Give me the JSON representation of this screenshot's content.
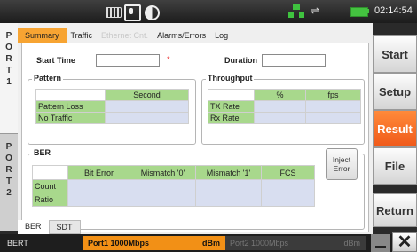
{
  "status_bar": {
    "time": "02:14:54",
    "icons": [
      "keyboard-icon",
      "screenshot-icon",
      "contrast-icon",
      "network-icon",
      "usb-icon",
      "battery-icon"
    ],
    "network_color": "#3fc23f",
    "battery_color": "#44c240"
  },
  "ports": {
    "port1": [
      "P",
      "O",
      "R",
      "T",
      "1"
    ],
    "port2": [
      "P",
      "O",
      "R",
      "T",
      "2"
    ]
  },
  "tabs": {
    "summary": "Summary",
    "traffic": "Traffic",
    "ethernet": "Ethernet Cnt.",
    "alarms": "Alarms/Errors",
    "log": "Log"
  },
  "form": {
    "start_time_label": "Start Time",
    "start_time_value": "",
    "required_mark": "*",
    "duration_label": "Duration",
    "duration_value": ""
  },
  "pattern": {
    "title": "Pattern",
    "header": "Second",
    "rows": [
      "Pattern Loss",
      "No Traffic"
    ]
  },
  "throughput": {
    "title": "Throughput",
    "headers": [
      "%",
      "fps"
    ],
    "rows": [
      "TX Rate",
      "Rx Rate"
    ]
  },
  "ber": {
    "title": "BER",
    "headers": [
      "Bit Error",
      "Mismatch '0'",
      "Mismatch '1'",
      "FCS"
    ],
    "rows": [
      "Count",
      "Ratio"
    ],
    "inject_label_1": "Inject",
    "inject_label_2": "Error"
  },
  "subtabs": {
    "ber": "BER",
    "sdt": "SDT"
  },
  "side_buttons": {
    "start": "Start",
    "setup": "Setup",
    "result": "Result",
    "file": "File",
    "return": "Return"
  },
  "bottom_bar": {
    "mode": "BERT",
    "port1": "Port1 1000Mbps",
    "port1_unit": "dBm",
    "port2": "Port2 1000Mbps",
    "port2_unit": "dBm",
    "close": "✕"
  },
  "colors": {
    "accent": "#f7a432",
    "active_button": "#f05a1a",
    "header_green": "#a8d88c",
    "cell_blue": "#d8def0"
  }
}
